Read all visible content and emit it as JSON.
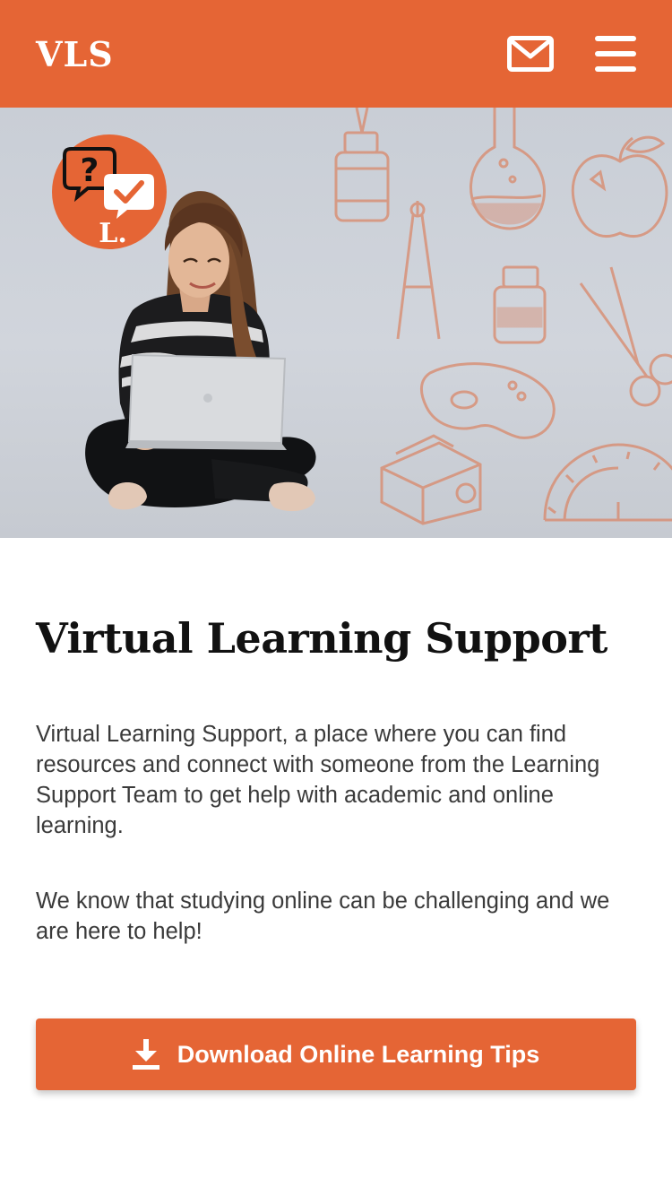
{
  "header": {
    "brand": "VLS",
    "mail_icon": "mail-icon",
    "menu_icon": "hamburger-menu-icon",
    "background_color": "#E56535"
  },
  "hero": {
    "badge_letter": "L.",
    "badge_icons": [
      "question-bubble-icon",
      "checkmark-bubble-icon"
    ],
    "doodle_icons": [
      "glue-bottle",
      "flask",
      "apple",
      "compass",
      "ink-bottle",
      "scissors",
      "paint-palette",
      "pencil-sharpener",
      "protractor"
    ],
    "accent_color": "#E56535"
  },
  "main": {
    "title": "Virtual Learning Support",
    "paragraph_1": "Virtual Learning Support, a place where you can find resources and connect with someone from the Learning Support Team to get help with academic and online learning.",
    "paragraph_2": "We know that studying online can be challenging and we are here to help!",
    "download_button": {
      "label": "Download Online Learning Tips",
      "icon": "download-icon"
    }
  }
}
